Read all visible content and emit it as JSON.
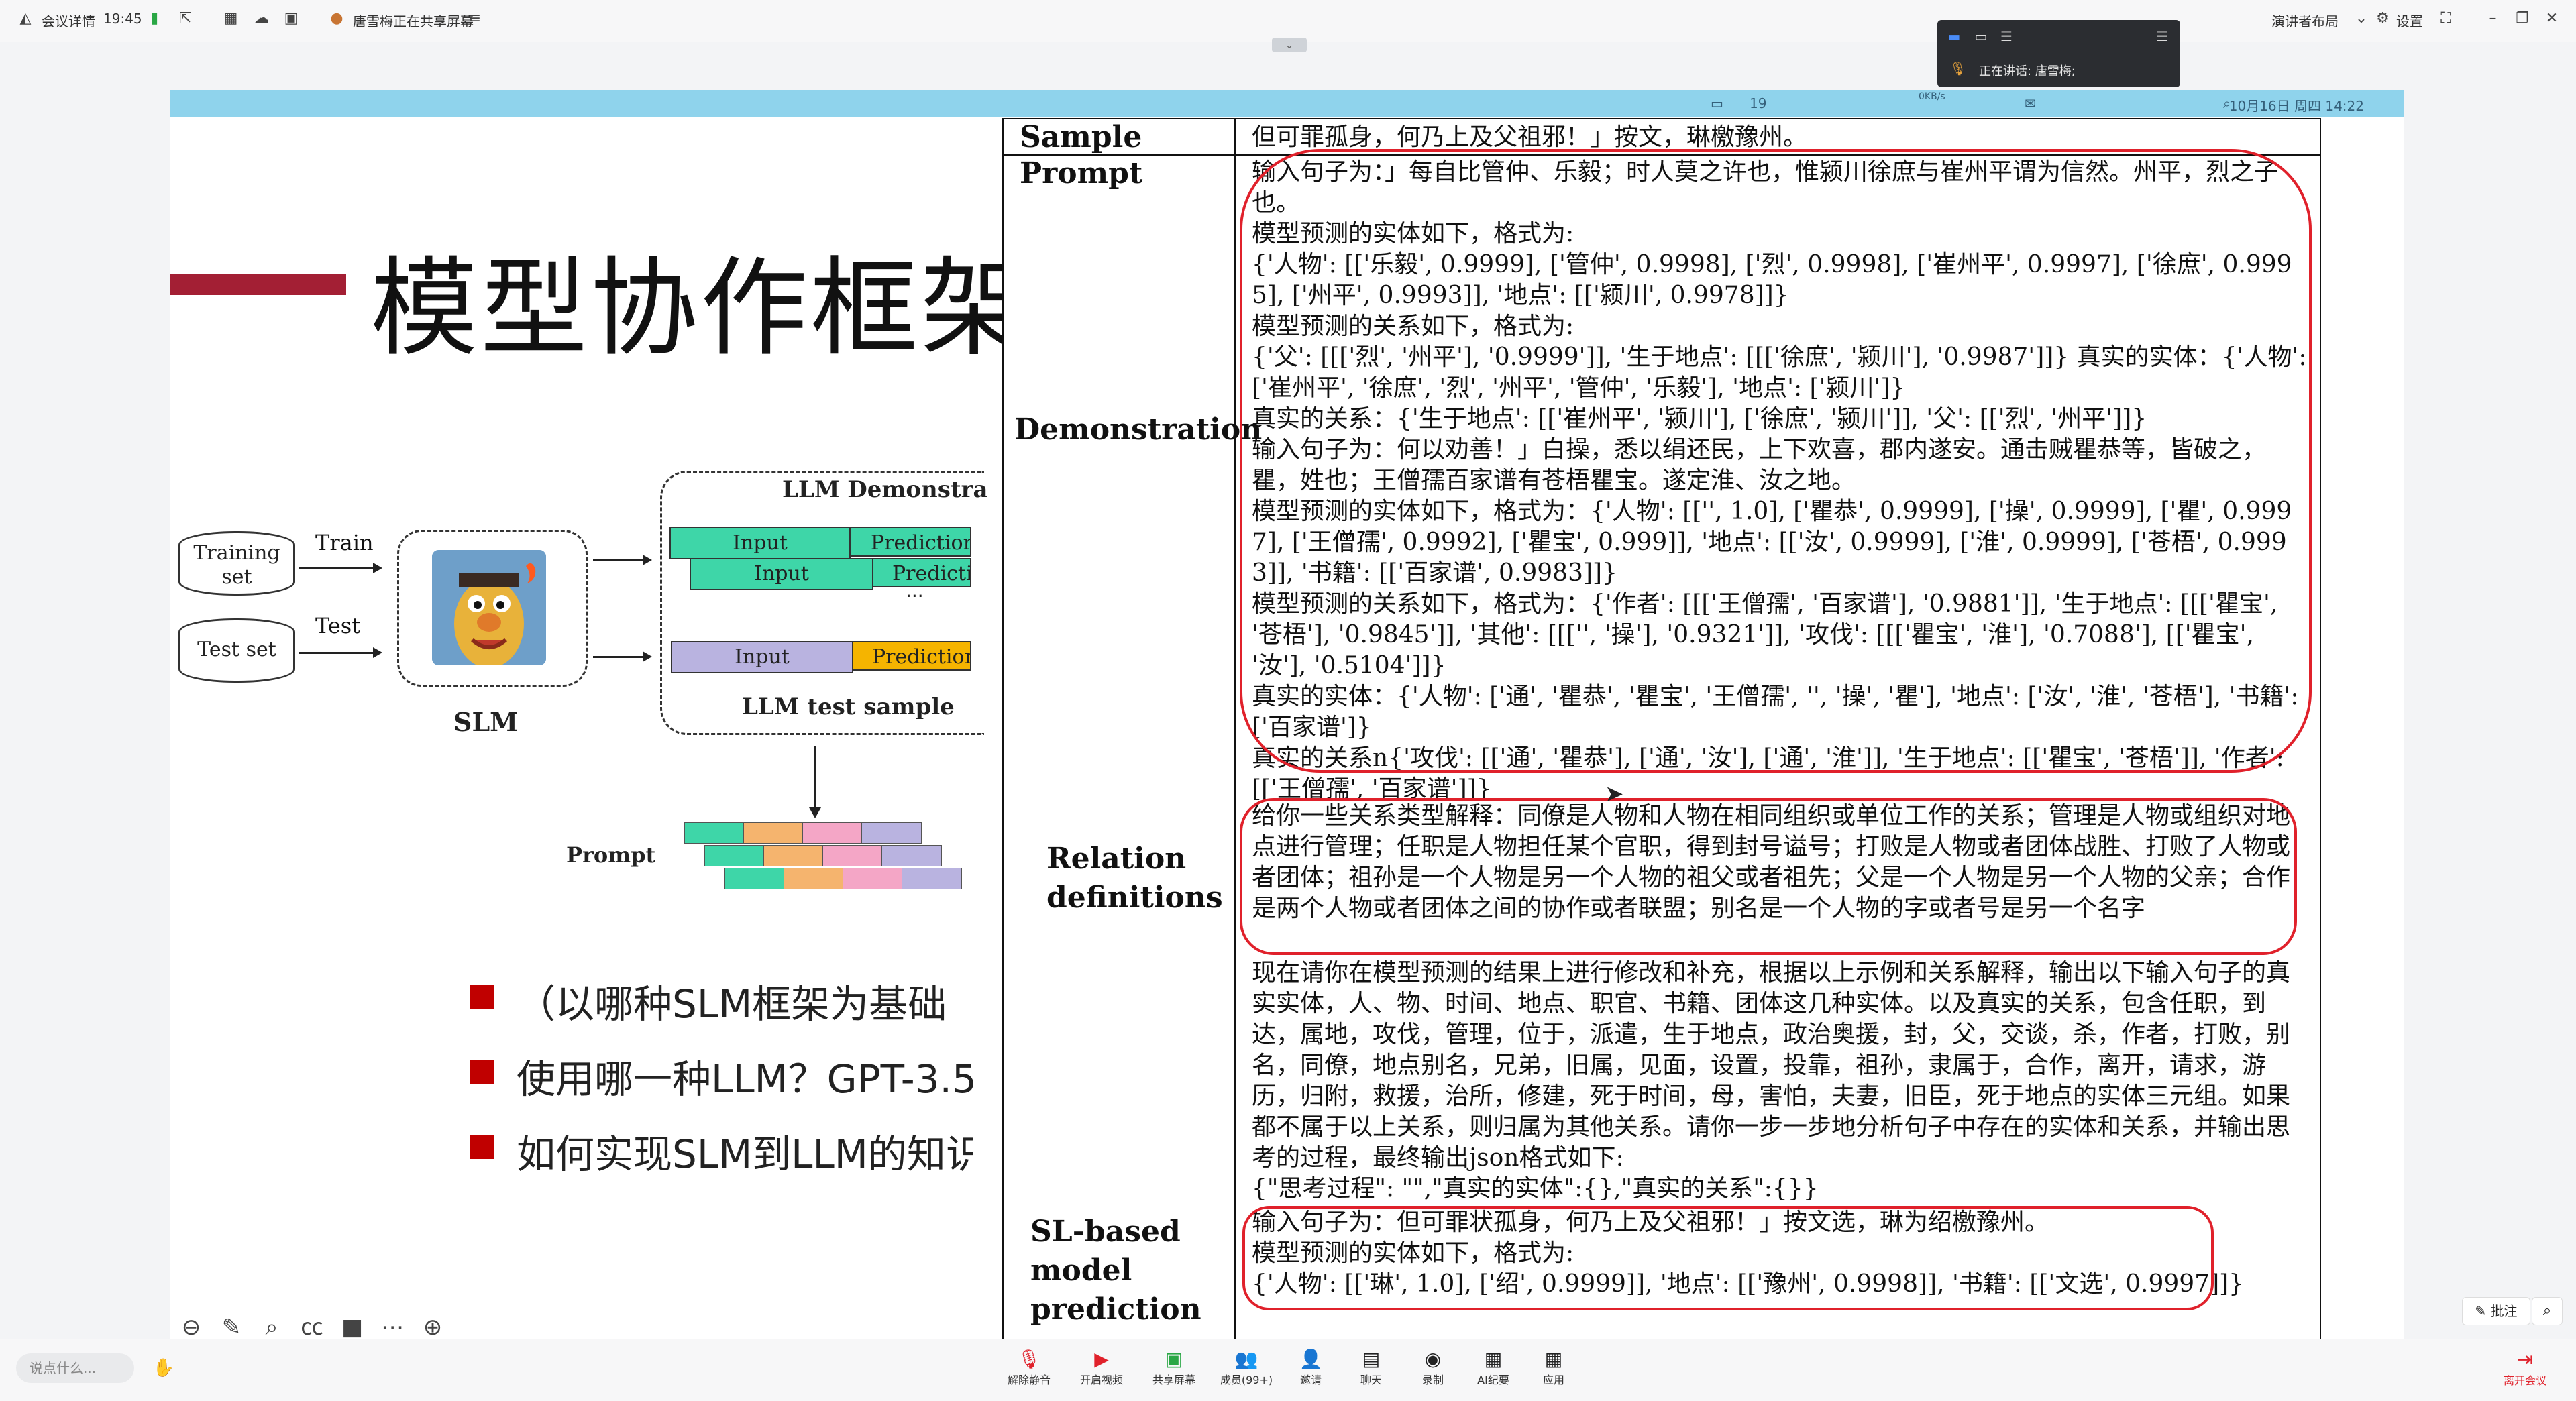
{
  "topbar": {
    "meeting_details": "会议详情",
    "time": "19:45",
    "sharing_notice": "唐雪梅正在共享屏幕",
    "presenter_layout": "演讲者布局",
    "settings": "设置"
  },
  "speaker_panel": {
    "speaking_label": "正在讲话:",
    "speaker_name": "唐雪梅;"
  },
  "mac_menubar": {
    "date_time": "10月16日 周四  14:22",
    "badge_count": "19",
    "net_speed": "0KB/s"
  },
  "slide": {
    "title": "模型协作框架",
    "training_set": "Training set",
    "test_set": "Test set",
    "train": "Train",
    "test": "Test",
    "slm": "SLM",
    "llm_demonstration": "LLM Demonstra",
    "llm_test_sample": "LLM test sample",
    "input": "Input",
    "prediction": "Prediction",
    "ellipsis": "...",
    "prompt": "Prompt",
    "bullets": [
      "（以哪种SLM框架为基础",
      "使用哪一种LLM？GPT-3.5",
      "如何实现SLM到LLM的知识"
    ]
  },
  "table": {
    "rows": [
      {
        "label": "Sample",
        "text": "但可罪孤身，何乃上及父祖邪！」按文，琳檄豫州。"
      },
      {
        "label": "Prompt",
        "text": "输入句子为：」每自比管仲、乐毅；时人莫之许也，惟颍川徐庶与崔州平谓为信然。州平，烈之子也。"
      },
      {
        "label": "Demonstration",
        "text": "模型预测的实体如下，格式为:\n{'人物': [['乐毅', 0.9999], ['管仲', 0.9998], ['烈', 0.9998], ['崔州平', 0.9997], ['徐庶', 0.9995], ['州平', 0.9993]], '地点': [['颍川', 0.9978]]}\n模型预测的关系如下，格式为:\n{'父': [[['烈', '州平'], '0.9999']], '生于地点': [[['徐庶', '颍川'], '0.9987']]} 真实的实体：{'人物': ['崔州平', '徐庶', '烈', '州平', '管仲', '乐毅'], '地点': ['颍川']}\n真实的关系：{'生于地点': [['崔州平', '颍川'], ['徐庶', '颍川']], '父': [['烈', '州平']]}\n输入句子为：何以劝善！」白操，悉以绢还民，上下欢喜，郡内遂安。通击贼瞿恭等，皆破之，瞿，姓也；王僧孺百家谱有苍梧瞿宝。遂定淮、汝之地。\n模型预测的实体如下，格式为：{'人物': [['', 1.0], ['瞿恭', 0.9999], ['操', 0.9999], ['瞿', 0.9997], ['王僧孺', 0.9992], ['瞿宝', 0.999]], '地点': [['汝', 0.9999], ['淮', 0.9999], ['苍梧', 0.9993]], '书籍': [['百家谱', 0.9983]]}\n模型预测的关系如下，格式为：{'作者': [[['王僧孺', '百家谱'], '0.9881']], '生于地点': [[['瞿宝', '苍梧'], '0.9845']], '其他': [[['', '操'], '0.9321']], '攻伐': [[['瞿宝', '淮'], '0.7088'], [['瞿宝', '汝'], '0.5104']]}\n真实的实体：{'人物': ['通', '瞿恭', '瞿宝', '王僧孺', '', '操', '瞿'], '地点': ['汝', '淮', '苍梧'], '书籍': ['百家谱']}\n真实的关系n{'攻伐': [['通', '瞿恭'], ['通', '汝'], ['通', '淮']], '生于地点': [['瞿宝', '苍梧']], '作者': [['王僧孺', '百家谱']]}"
      },
      {
        "label": "Relation definitions",
        "text": "给你一些关系类型解释：同僚是人物和人物在相同组织或单位工作的关系；管理是人物或组织对地点进行管理；任职是人物担任某个官职，得到封号谥号；打败是人物或者团体战胜、打败了人物或者团体；祖孙是一个人物是另一个人物的祖父或者祖先；父是一个人物是另一个人物的父亲；合作是两个人物或者团体之间的协作或者联盟；别名是一个人物的字或者号是另一个名字"
      },
      {
        "label": "",
        "text": "现在请你在模型预测的结果上进行修改和补充，根据以上示例和关系解释，输出以下输入句子的真实实体，人、物、时间、地点、职官、书籍、团体这几种实体。以及真实的关系，包含任职，到达，属地，攻伐，管理，位于，派遣，生于地点，政治奥援，封，父，交谈，杀，作者，打败，别名，同僚，地点别名，兄弟，旧属，见面，设置，投靠，祖孙，隶属于，合作，离开，请求，游历，归附，救援，治所，修建，死于时间，母，害怕，夫妻，旧臣，死于地点的实体三元组。如果都不属于以上关系，则归属为其他关系。请你一步一步地分析句子中存在的实体和关系，并输出思考的过程，最终输出json格式如下:\n{\"思考过程\": \"\",\"真实的实体\":{},\"真实的关系\":{}}"
      },
      {
        "label": "SL-based model prediction",
        "text": "输入句子为：但可罪状孤身，何乃上及父祖邪！」按文选，琳为绍檄豫州。\n模型预测的实体如下，格式为:\n{'人物': [['琳', 1.0], ['绍', 0.9999]], '地点': [['豫州', 0.9998]], '书籍': [['文选', 0.9997]]}"
      }
    ]
  },
  "side_buttons": {
    "annotate": "批注"
  },
  "bottombar": {
    "say_placeholder": "说点什么...",
    "items": [
      {
        "icon": "mic-muted-icon",
        "label": "解除静音"
      },
      {
        "icon": "video-off-icon",
        "label": "开启视频"
      },
      {
        "icon": "share-screen-icon",
        "label": "共享屏幕"
      },
      {
        "icon": "members-icon",
        "label": "成员(99+)"
      },
      {
        "icon": "invite-icon",
        "label": "邀请"
      },
      {
        "icon": "chat-icon",
        "label": "聊天"
      },
      {
        "icon": "record-icon",
        "label": "录制"
      },
      {
        "icon": "ai-minutes-icon",
        "label": "AI纪要"
      },
      {
        "icon": "apps-icon",
        "label": "应用"
      }
    ],
    "leave": "离开会议"
  },
  "colors": {
    "accent_red": "#e0212b",
    "title_bar": "#a31f34",
    "menubar": "#8fd3ec",
    "teal": "#3ed6a8",
    "purple": "#b9b3e0",
    "orange": "#f5b400"
  }
}
